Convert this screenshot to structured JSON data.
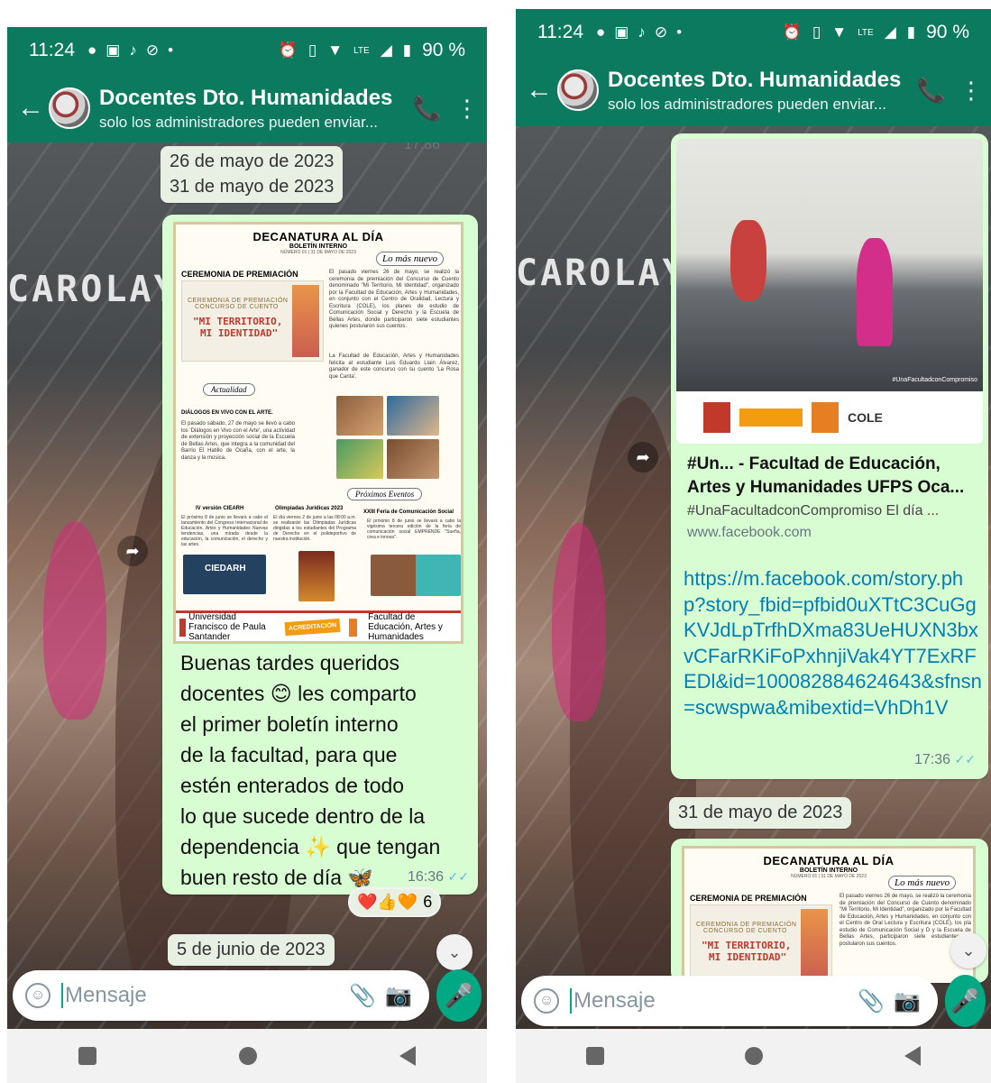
{
  "phone1": {
    "status": {
      "time": "11:24",
      "battery": "90 %",
      "icons": [
        "chat-icon",
        "facebook-icon",
        "tiktok-icon",
        "pinterest-icon",
        "dot-icon"
      ],
      "right_icons": [
        "alarm-icon",
        "vibrate-icon",
        "wifi-icon",
        "volte-icon",
        "signal-icon",
        "battery-icon"
      ]
    },
    "header": {
      "title": "Docentes Dto. Humanidades",
      "subtitle": "solo los administradores pueden enviar..."
    },
    "top_time": "17:36",
    "dates": [
      "26 de mayo de 2023",
      "31 de mayo de 2023"
    ],
    "watermark": "CAROLAY GU",
    "newsletter": {
      "title": "DECANATURA AL DÍA",
      "subtitle": "BOLETÍN INTERNO",
      "number": "NÚMERO 01 | 31 DE MAYO DE 2023",
      "lo_mas_nuevo": "Lo más nuevo",
      "ceremony_title": "CEREMONIA DE PREMIACIÓN",
      "ceremony_l1": "CEREMONIA DE PREMIACIÓN",
      "ceremony_l2": "CONCURSO DE CUENTO",
      "ceremony_l3": "\"MI TERRITORIO,",
      "ceremony_l4": "MI IDENTIDAD\"",
      "ceremony_text": "El pasado viernes 26 de mayo, se realizó la ceremonia de premiación del Concurso de Cuento denominado \"Mi Territorio, Mi Identidad\", organizado por la Facultad de Educación, Artes y Humanidades, en conjunto con el Centro de Oralidad, Lectura y Escritura (COLE), los planes de estudio de Comunicación Social y Derecho y la Escuela de Bellas Artes, donde participaron siete estudiantes quienes postularon sus cuentos.",
      "ceremony_text2": "La Facultad de Educación, Artes y Humanidades felicita al estudiante Luis Eduardo Llain Álvarez, ganador de este concurso con su cuento 'La Rosa que Canta'.",
      "actualidad": "Actualidad",
      "dialogos_title": "DIÁLOGOS EN VIVO CON EL ARTE.",
      "dialogos_text": "El pasado sábado, 27 de mayo se llevó a cabo los 'Diálogos en Vivo con el Arte', una actividad de extensión y proyección social de la Escuela de Bellas Artes, que integra a la comunidad del Barrio El Hatillo de Ocaña, con el arte, la danza y la música.",
      "proximos": "Próximos Eventos",
      "ev1_title": "IV versión CIEARH",
      "ev1_text": "El próximo 8 de junio se llevará a cabo el lanzamiento del Congreso Internacional de Educación, Artes y Humanidades Nuevas tendencias, una mirada desde la educación, la comunicación, el derecho y las artes.",
      "ev2_title": "Olimpiadas Jurídicas 2023",
      "ev2_text": "El día viernes 2 de junio a las 08:00 a.m. se realizarán las Olimpiadas Jurídicas dirigidas a los estudiantes del Programa de Derecho en el polideportivo de nuestra institución.",
      "ev3_title": "XXIII Feria de Comunicación Social",
      "ev3_text": "El próximo 8 de junio se llevará a cabo la vigésima tercera edición de la feria de comunicación social EMPRENDE \"Sueña, crea e innova\".",
      "ciedarh": "CIEDARH",
      "footer_univ": "Universidad Francisco de Paula Santander",
      "footer_acred": "ACREDITACIÓN",
      "footer_fac": "Facultad de Educación, Artes y Humanidades"
    },
    "message": {
      "lines": [
        "Buenas tardes queridos",
        "docentes 😊 les comparto",
        "el primer boletín interno",
        "de la facultad, para que",
        "estén enterados de todo",
        "lo que sucede dentro de la",
        "dependencia ✨ que tengan",
        "buen resto de día 🦋"
      ],
      "time": "16:36"
    },
    "reactions": {
      "emojis": "❤️👍🧡",
      "count": "6"
    },
    "date_bottom": "5 de junio de 2023",
    "input_placeholder": "Mensaje"
  },
  "phone2": {
    "status": {
      "time": "11:24",
      "battery": "90 %"
    },
    "header": {
      "title": "Docentes Dto. Humanidades",
      "subtitle": "solo los administradores pueden enviar..."
    },
    "watermark": "CAROLAY GU",
    "preview": {
      "img_caption": "#UnaFacultadconCompromiso",
      "logo_text": "COLE",
      "title": "#Un... - Facultad de Educación, Artes y Humanidades UFPS Oca...",
      "desc": "#UnaFacultadconCompromiso El día ...",
      "domain": "www.facebook.com"
    },
    "link": "https://m.facebook.com/story.php?story_fbid=pfbid0uXTtC3CuGgKVJdLpTrfhDXma83UeHUXN3bxvCFarRKiFoPxhnjiVak4YT7ExRFEDl&id=100082884624643&sfnsn=scwspwa&mibextid=VhDh1V",
    "link_time": "17:36",
    "date": "31 de mayo de 2023",
    "newsletter": {
      "title": "DECANATURA AL DÍA",
      "subtitle": "BOLETÍN INTERNO",
      "number": "NÚMERO 01 | 31 DE MAYO DE 2023",
      "lo_mas_nuevo": "Lo más nuevo",
      "ceremony_title": "CEREMONIA DE PREMIACIÓN",
      "ceremony_l1": "CEREMONIA DE PREMIACIÓN",
      "ceremony_l2": "CONCURSO DE CUENTO",
      "ceremony_l3": "\"MI TERRITORIO,",
      "ceremony_l4": "MI IDENTIDAD\"",
      "ceremony_text": "El pasado viernes 26 de mayo, se realizó la ceremonia de premiación del Concurso de Cuento denominado \"Mi Territorio, Mi Identidad\", organizado por la Facultad de Educación, Artes y Humanidades, en conjunto con el Centro de Oral Lectura y Escritura (COLE), los pla estudio de Comunicación Social y D y la Escuela de Bellas Artes, participaron siete estudiantes qu postularon sus cuentos."
    },
    "input_placeholder": "Mensaje"
  },
  "colors": {
    "header": "#0b7a5e",
    "bubble": "#d9fdd3",
    "accent": "#00a884",
    "link": "#027eb5",
    "tick": "#53bdeb"
  }
}
